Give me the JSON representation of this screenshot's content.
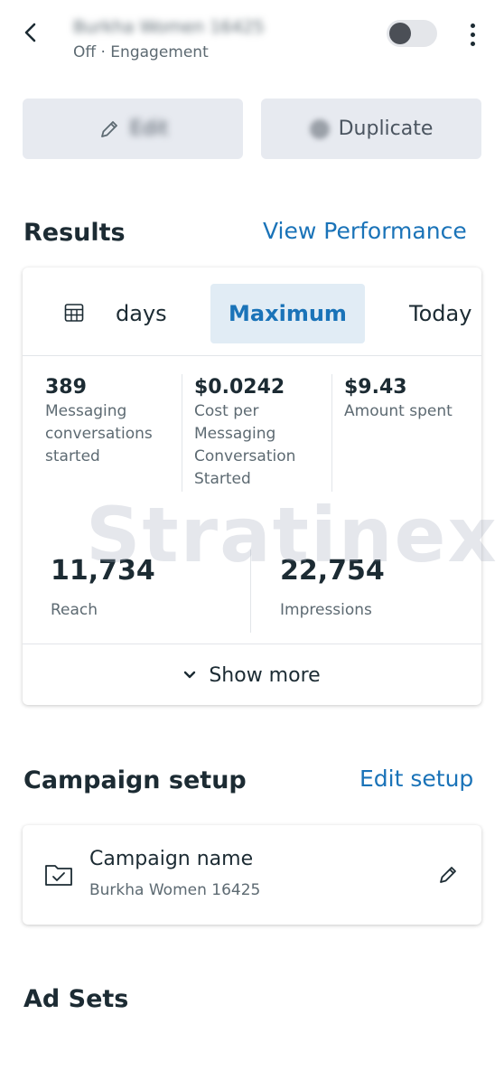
{
  "header": {
    "title": "Burkha Women 16425",
    "subtitle": "Off · Engagement"
  },
  "actions": {
    "edit_label": "Edit",
    "duplicate_label": "Duplicate"
  },
  "results": {
    "title": "Results",
    "view_performance": "View Performance",
    "tabs": {
      "days": "days",
      "maximum": "Maximum",
      "today": "Today"
    },
    "metrics": [
      {
        "value": "389",
        "label": "Messaging conversations started"
      },
      {
        "value": "$0.0242",
        "label": "Cost per Messaging Conversation Started"
      },
      {
        "value": "$9.43",
        "label": "Amount spent"
      }
    ],
    "big_metrics": [
      {
        "value": "11,734",
        "label": "Reach"
      },
      {
        "value": "22,754",
        "label": "Impressions"
      }
    ],
    "show_more": "Show more"
  },
  "watermark": "Stratinex",
  "campaign_setup": {
    "title": "Campaign setup",
    "edit_link": "Edit setup",
    "name_label": "Campaign name",
    "name_value": "Burkha Women 16425"
  },
  "ad_sets": {
    "title": "Ad Sets"
  },
  "colors": {
    "accent": "#1a73b8",
    "active_tab_bg": "#e1ecf5",
    "button_bg": "#e7eaf0"
  }
}
